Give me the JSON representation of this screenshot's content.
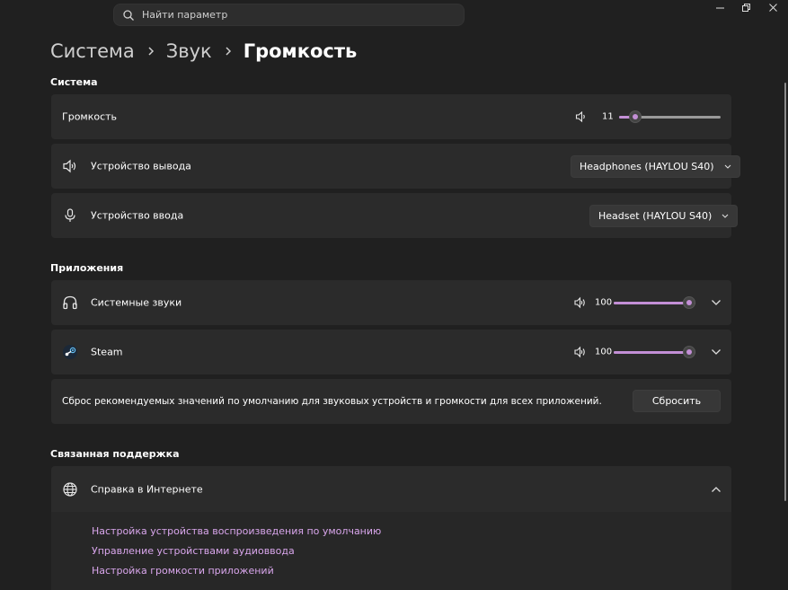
{
  "search": {
    "placeholder": "Найти параметр"
  },
  "breadcrumb": {
    "level1": "Система",
    "level2": "Звук",
    "current": "Громкость"
  },
  "system_section": {
    "title": "Система",
    "volume": {
      "label": "Громкость",
      "value": "11",
      "level_percent": 11
    },
    "output_device": {
      "label": "Устройство вывода",
      "selected": "Headphones (HAYLOU S40)"
    },
    "input_device": {
      "label": "Устройство ввода",
      "selected": "Headset (HAYLOU S40)"
    }
  },
  "apps_section": {
    "title": "Приложения",
    "apps": [
      {
        "name": "Системные звуки",
        "volume": "100",
        "level_percent": 100,
        "icon": "headphones-icon"
      },
      {
        "name": "Steam",
        "volume": "100",
        "level_percent": 100,
        "icon": "steam-icon"
      }
    ],
    "reset": {
      "text": "Сброс рекомендуемых значений по умолчанию для звуковых устройств и громкости для всех приложений.",
      "button_label": "Сбросить"
    }
  },
  "support_section": {
    "title": "Связанная поддержка",
    "help": {
      "label": "Справка в Интернете"
    },
    "links": [
      "Настройка устройства воспроизведения по умолчанию",
      "Управление устройствами аудиоввода",
      "Настройка громкости приложений"
    ]
  },
  "colors": {
    "accent": "#c38fd6",
    "link": "#d9a6ec",
    "background": "#202020",
    "card": "#2b2b2b"
  }
}
